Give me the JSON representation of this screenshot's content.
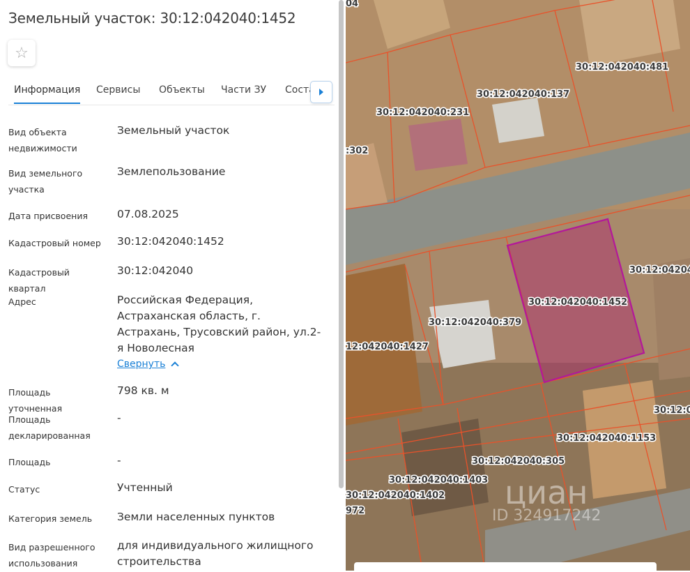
{
  "panel": {
    "title": "Земельный участок: 30:12:042040:1452",
    "tabs": [
      "Информация",
      "Сервисы",
      "Объекты",
      "Части ЗУ",
      "Соста"
    ],
    "active_tab": 0,
    "fields": [
      {
        "label": "Вид объекта недвижимости",
        "value": "Земельный участок"
      },
      {
        "label": "Вид земельного участка",
        "value": "Землепользование"
      },
      {
        "label": "Дата присвоения",
        "value": "07.08.2025"
      },
      {
        "label": "Кадастровый номер",
        "value": "30:12:042040:1452"
      },
      {
        "label": "Кадастровый квартал",
        "value": "30:12:042040"
      },
      {
        "label": "Адрес",
        "value": "Российская Федерация, Астраханская область, г. Астрахань, Трусовский район, ул.2-я Новолесная"
      },
      {
        "label": "Площадь уточненная",
        "value": "798 кв. м"
      },
      {
        "label": "Площадь декларированная",
        "value": "-"
      },
      {
        "label": "Площадь",
        "value": "-"
      },
      {
        "label": "Статус",
        "value": "Учтенный"
      },
      {
        "label": "Категория земель",
        "value": "Земли населенных пунктов"
      },
      {
        "label": "Вид разрешенного использования",
        "value": "для индивидуального жилищного строительства"
      }
    ],
    "collapse_link": "Свернуть"
  },
  "map": {
    "labels": [
      "04",
      "30:12:042040:481",
      "30:12:042040:137",
      "30:12:042040:231",
      ":302",
      "30:12:04204",
      "30:12:042040:1452",
      "30:12:042040:379",
      "12:042040:1427",
      "30:12:0",
      "30:12:042040:1153",
      "30:12:042040:305",
      "30:12:042040:1403",
      "30:12:042040:1402",
      "972"
    ],
    "watermark": "циан",
    "watermark_id": "ID 324917242",
    "colors": {
      "parcel_border": "#e8522a",
      "selected_border": "#b3189a",
      "selected_fill": "#b02070"
    }
  }
}
